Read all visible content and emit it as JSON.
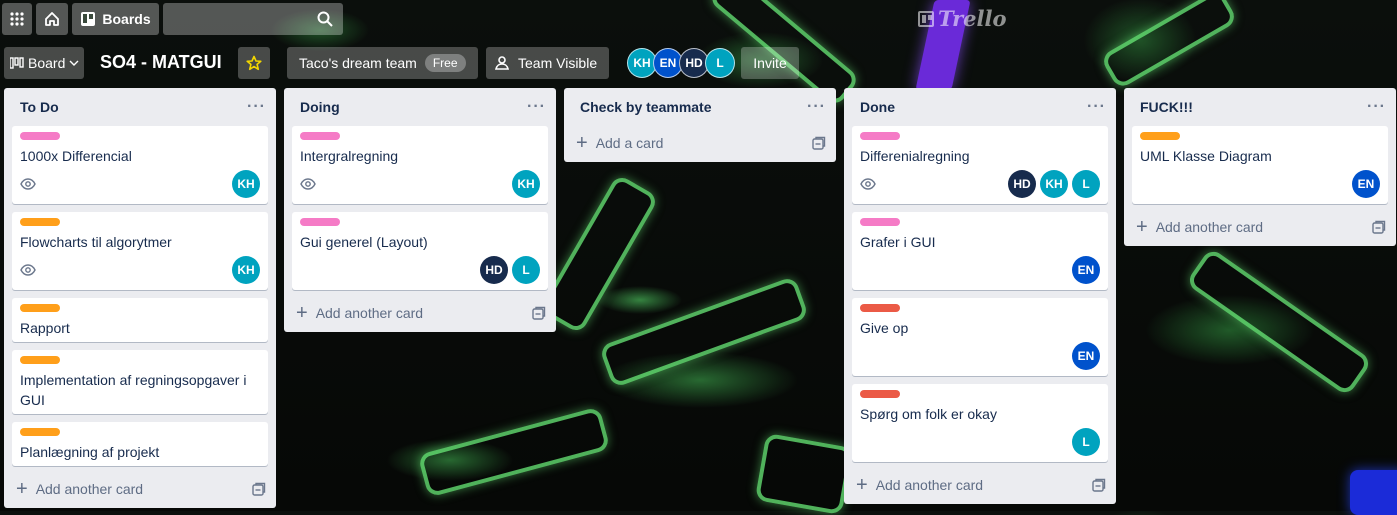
{
  "colors": {
    "label_pink": "#f57bc6",
    "label_orange": "#ff9f1a",
    "label_red": "#eb5a46",
    "av_kh": "#00a3bf",
    "av_en": "#0052cc",
    "av_hd": "#172b4d",
    "av_l": "#00a3bf"
  },
  "topbar": {
    "apps_icon": "grid-icon",
    "home_icon": "home-icon",
    "boards_label": "Boards",
    "search_icon": "search-icon",
    "logo_text": "Trello"
  },
  "board_header": {
    "view_label": "Board",
    "title": "SO4 - MATGUI",
    "team_name": "Taco's dream team",
    "team_badge": "Free",
    "visibility_label": "Team Visible",
    "invite_label": "Invite",
    "members": [
      "KH",
      "EN",
      "HD",
      "L"
    ]
  },
  "lists": [
    {
      "title": "To Do",
      "add_label": "Add another card",
      "cards": [
        {
          "label": "pink",
          "title": "1000x Differencial",
          "watch": true,
          "members": [
            "KH"
          ]
        },
        {
          "label": "orange",
          "title": "Flowcharts til algorytmer",
          "watch": true,
          "members": [
            "KH"
          ]
        },
        {
          "label": "orange",
          "title": "Rapport",
          "watch": false,
          "members": []
        },
        {
          "label": "orange",
          "title": "Implementation af regningsopgaver i GUI",
          "watch": false,
          "members": []
        },
        {
          "label": "orange",
          "title": "Planlægning af projekt",
          "watch": false,
          "members": []
        }
      ]
    },
    {
      "title": "Doing",
      "add_label": "Add another card",
      "cards": [
        {
          "label": "pink",
          "title": "Intergralregning",
          "watch": true,
          "members": [
            "KH"
          ]
        },
        {
          "label": "pink",
          "title": "Gui generel (Layout)",
          "watch": false,
          "members": [
            "HD",
            "L"
          ]
        }
      ]
    },
    {
      "title": "Check by teammate",
      "add_label": "Add a card",
      "cards": []
    },
    {
      "title": "Done",
      "add_label": "Add another card",
      "cards": [
        {
          "label": "pink",
          "title": "Differenialregning",
          "watch": true,
          "members": [
            "HD",
            "KH",
            "L"
          ]
        },
        {
          "label": "pink",
          "title": "Grafer i GUI",
          "watch": false,
          "members": [
            "EN"
          ]
        },
        {
          "label": "red",
          "title": "Give op",
          "watch": false,
          "members": [
            "EN"
          ]
        },
        {
          "label": "red",
          "title": "Spørg om folk er okay",
          "watch": false,
          "members": [
            "L"
          ]
        }
      ]
    },
    {
      "title": "FUCK!!!",
      "add_label": "Add another card",
      "cards": [
        {
          "label": "orange",
          "title": "UML Klasse Diagram",
          "watch": false,
          "members": [
            "EN"
          ]
        }
      ]
    }
  ]
}
